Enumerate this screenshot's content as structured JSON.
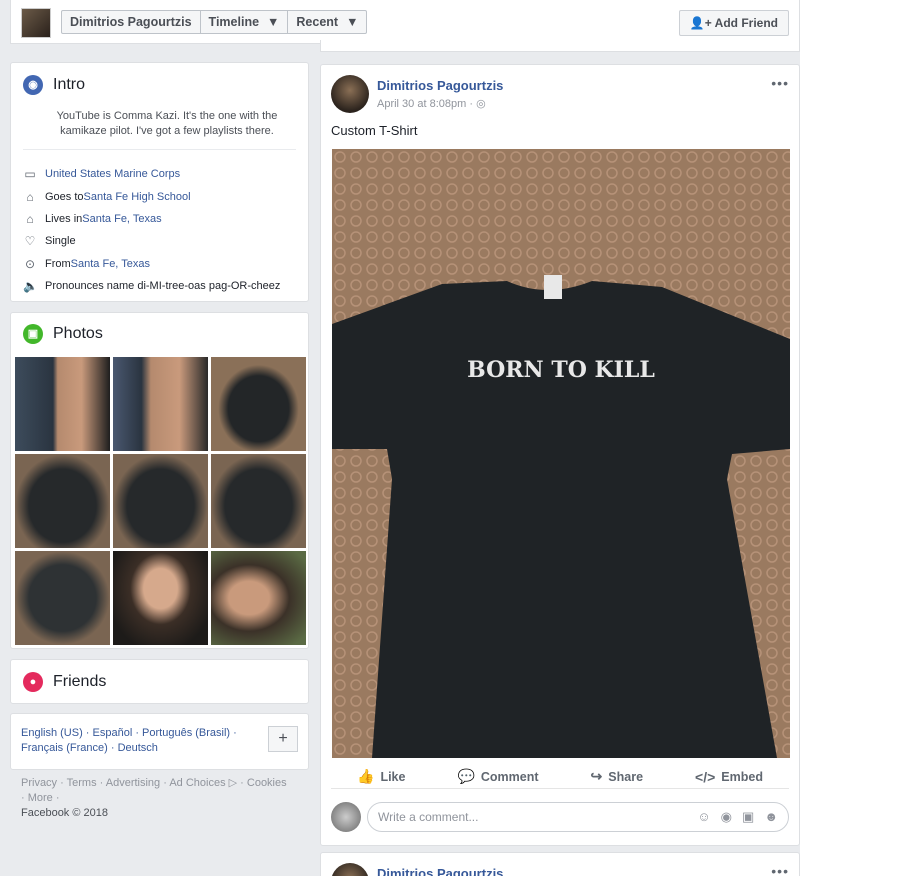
{
  "topbar": {
    "name": "Dimitrios Pagourtzis",
    "timeline": "Timeline",
    "recent": "Recent",
    "add_friend": "Add Friend"
  },
  "intro": {
    "title": "Intro",
    "bio_line1": "YouTube is Comma Kazi. It's the one with the",
    "bio_line2": "kamikaze pilot. I've got a few playlists there.",
    "items": [
      {
        "icon": "briefcase-icon",
        "prefix": "",
        "link": "United States Marine Corps"
      },
      {
        "icon": "graduation-cap-icon",
        "prefix": "Goes to ",
        "link": "Santa Fe High School"
      },
      {
        "icon": "home-icon",
        "prefix": "Lives in ",
        "link": "Santa Fe, Texas"
      },
      {
        "icon": "heart-icon",
        "prefix": "Single",
        "link": ""
      },
      {
        "icon": "location-pin-icon",
        "prefix": "From ",
        "link": "Santa Fe, Texas"
      },
      {
        "icon": "speaker-icon",
        "prefix": "Pronounces name di-MI-tree-oas pag-OR-cheez",
        "link": ""
      }
    ]
  },
  "photos": {
    "title": "Photos"
  },
  "friends": {
    "title": "Friends"
  },
  "languages": {
    "line1": "English (US) · Español · Português (Brasil) ·",
    "line2": "Français (France) · Deutsch",
    "plus": "+"
  },
  "footer": {
    "line1": "Privacy · Terms · Advertising · Ad Choices ▷ · Cookies",
    "line2": "· More ·",
    "copyright": "Facebook © 2018"
  },
  "post": {
    "author": "Dimitrios Pagourtzis",
    "date": "April 30 at 8:08pm · ",
    "menu": "•••",
    "caption": "Custom T-Shirt",
    "shirt_text": "BORN TO KILL",
    "actions": {
      "like": "Like",
      "comment": "Comment",
      "share": "Share",
      "embed": "Embed"
    },
    "comment_placeholder": "Write a comment..."
  },
  "post2": {
    "author": "Dimitrios Pagourtzis",
    "menu": "•••"
  },
  "colors": {
    "link": "#365899",
    "background": "#e9ebee",
    "intro_icon": "#4267b2",
    "photos_icon": "#42b72a",
    "friends_icon": "#e42a5d"
  }
}
